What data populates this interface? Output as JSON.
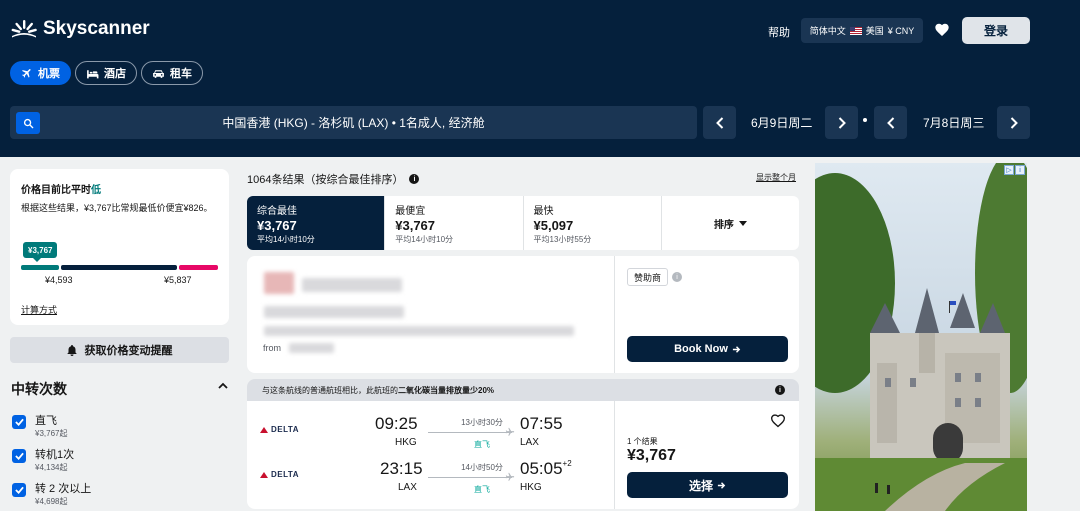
{
  "header": {
    "logo_text": "Skyscanner",
    "help": "帮助",
    "locale": {
      "language": "简体中文",
      "region": "美国",
      "currency": "¥ CNY"
    },
    "login": "登录",
    "tabs": [
      {
        "label": "机票",
        "icon": "plane-icon",
        "active": true
      },
      {
        "label": "酒店",
        "icon": "bed-icon",
        "active": false
      },
      {
        "label": "租车",
        "icon": "car-icon",
        "active": false
      }
    ],
    "search_summary": "中国香港 (HKG) - 洛杉矶 (LAX)  •  1名成人, 经济舱",
    "depart_date": "6月9日周二",
    "return_date": "7月8日周三"
  },
  "price_card": {
    "title_prefix": "价格目前比平时",
    "title_highlight": "低",
    "description": "根据这些结果，¥3,767比常规最低价便宜¥826。",
    "badge": "¥3,767",
    "low_tick": "¥4,593",
    "high_tick": "¥5,837",
    "link": "计算方式"
  },
  "alert_button": "获取价格变动提醒",
  "stops": {
    "title": "中转次数",
    "options": [
      {
        "label": "直飞",
        "price": "¥3,767起",
        "checked": true
      },
      {
        "label": "转机1次",
        "price": "¥4,134起",
        "checked": true
      },
      {
        "label": "转 2 次以上",
        "price": "¥4,698起",
        "checked": true
      }
    ]
  },
  "results": {
    "count_text": "1064条结果（按综合最佳排序）",
    "show_month": "显示整个月",
    "sort_tabs": [
      {
        "label": "综合最佳",
        "price": "¥3,767",
        "time": "平均14小时10分",
        "active": true
      },
      {
        "label": "最便宜",
        "price": "¥3,767",
        "time": "平均14小时10分",
        "active": false
      },
      {
        "label": "最快",
        "price": "¥5,097",
        "time": "平均13小时55分",
        "active": false
      }
    ],
    "sort_label": "排序"
  },
  "ad_card": {
    "from": "from",
    "sponsor": "赞助商",
    "book_now": "Book Now"
  },
  "eco_banner": {
    "text_prefix": "与这条航线的普通航班相比，此航班的",
    "text_bold": "二氧化碳当量排放量少20%"
  },
  "flight": {
    "airline": "DELTA",
    "legs": [
      {
        "dep_time": "09:25",
        "dep_airport": "HKG",
        "arr_time": "07:55",
        "arr_airport": "LAX",
        "arr_plus": "",
        "duration": "13小时30分",
        "stops": "直飞"
      },
      {
        "dep_time": "23:15",
        "dep_airport": "LAX",
        "arr_time": "05:05",
        "arr_airport": "HKG",
        "arr_plus": "+2",
        "duration": "14小时50分",
        "stops": "直飞"
      }
    ],
    "result_count": "1 个结果",
    "price": "¥3,767",
    "select": "选择"
  },
  "colors": {
    "brand_navy": "#05203c",
    "accent_blue": "#0062e3",
    "good_teal": "#007a7a",
    "direct_green": "#00a698",
    "high_pink": "#e70866"
  }
}
